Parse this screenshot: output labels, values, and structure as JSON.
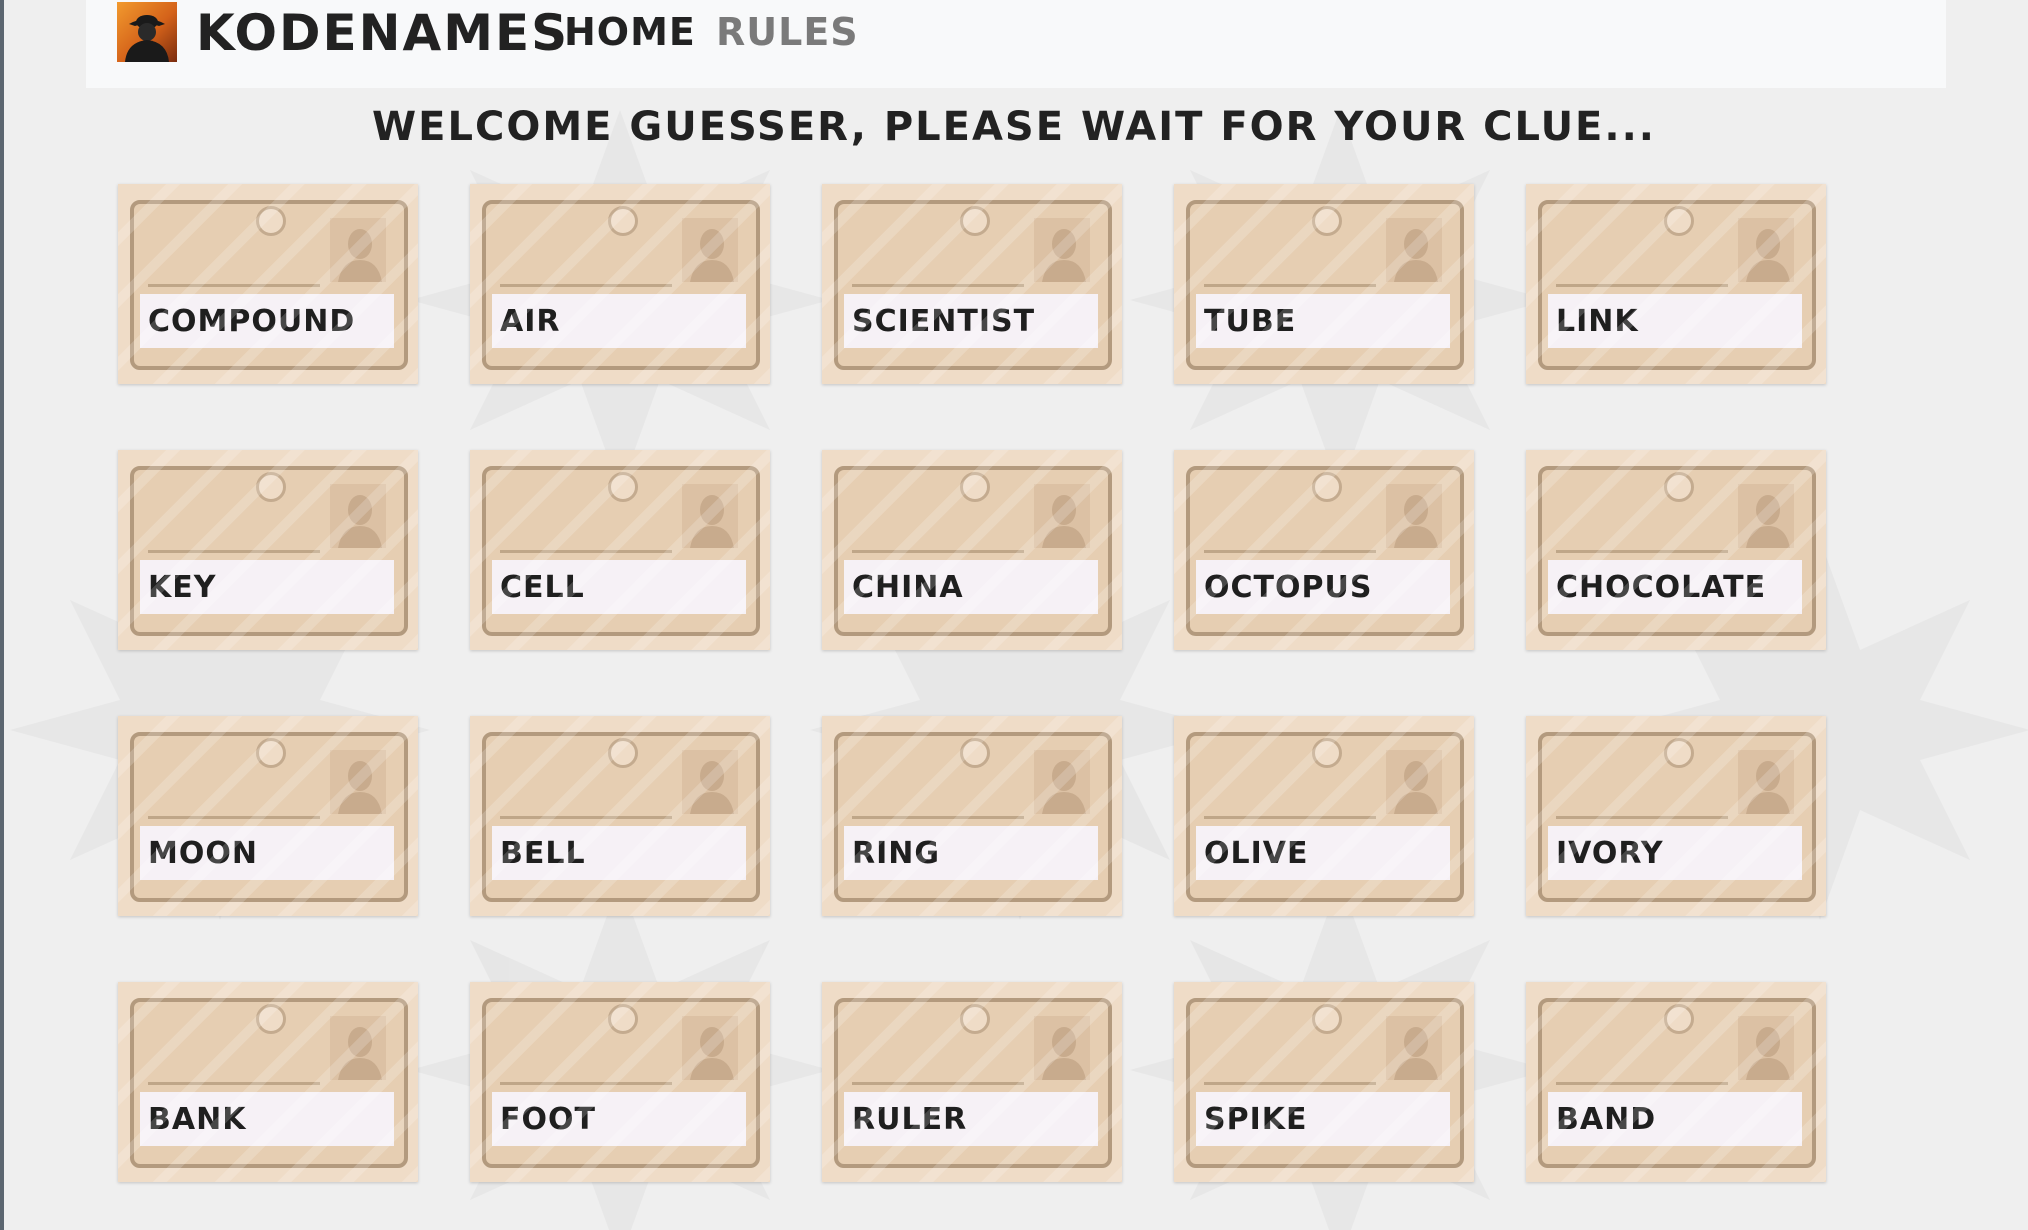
{
  "header": {
    "brand": "KODENAMES",
    "nav": {
      "home": "HOME",
      "rules": "RULES"
    }
  },
  "welcome_message": "WELCOME GUESSER, PLEASE WAIT FOR YOUR CLUE...",
  "board": {
    "cards": [
      "COMPOUND",
      "AIR",
      "SCIENTIST",
      "TUBE",
      "LINK",
      "KEY",
      "CELL",
      "CHINA",
      "OCTOPUS",
      "CHOCOLATE",
      "MOON",
      "BELL",
      "RING",
      "OLIVE",
      "IVORY",
      "BANK",
      "FOOT",
      "RULER",
      "SPIKE",
      "BAND"
    ]
  },
  "icons": {
    "logo": "spy-silhouette-icon",
    "card_photo": "person-silhouette-icon",
    "background": "starburst-pattern"
  },
  "colors": {
    "page_background": "#efefef",
    "card": "#efdcc7",
    "card_border": "#b39a7e",
    "label_background": "#f6f1f6",
    "nav_inactive": "#7a7a7a"
  }
}
